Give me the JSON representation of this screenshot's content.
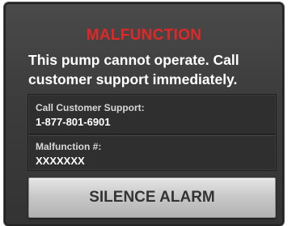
{
  "dialog": {
    "title": "MALFUNCTION",
    "message_line1": "This pump cannot operate. Call",
    "message_line2": "customer support immediately."
  },
  "info": {
    "support_label": "Call Customer Support:",
    "support_phone": "1-877-801-6901",
    "malfunction_label": "Malfunction #:",
    "malfunction_code": "XXXXXXX"
  },
  "actions": {
    "silence_label": "SILENCE ALARM"
  },
  "colors": {
    "title": "#e32626",
    "background": "#3d3d3d",
    "button": "#c9c9c9"
  }
}
